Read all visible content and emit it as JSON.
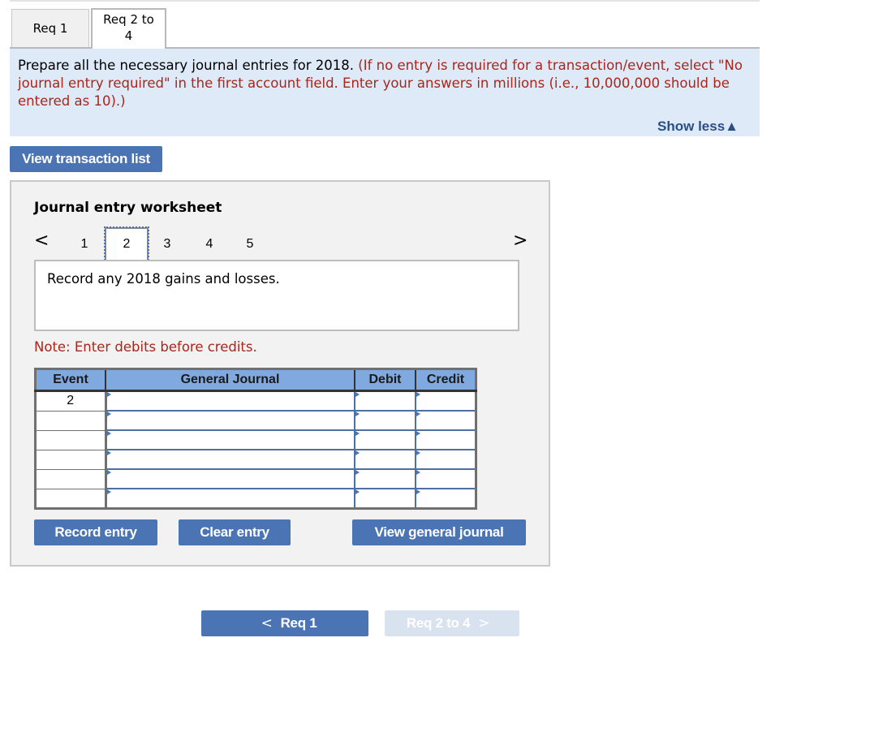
{
  "tabs": [
    {
      "label": "Req 1",
      "active": false
    },
    {
      "label_line1": "Req 2 to",
      "label_line2": "4",
      "active": true
    }
  ],
  "instructions": {
    "main": "Prepare all the necessary journal entries for 2018.",
    "note": "(If no entry is required for a transaction/event, select \"No journal entry required\" in the first account field. Enter your answers in millions (i.e., 10,000,000 should be entered as 10).)",
    "show_less_label": "Show less",
    "show_less_icon": "▲"
  },
  "view_transaction_list_label": "View transaction list",
  "worksheet": {
    "title": "Journal entry worksheet",
    "pager": {
      "prev_icon": "<",
      "next_icon": ">",
      "pages": [
        "1",
        "2",
        "3",
        "4",
        "5"
      ],
      "current": "2"
    },
    "description": "Record any 2018 gains and losses.",
    "note": "Note: Enter debits before credits.",
    "table": {
      "headers": [
        "Event",
        "General Journal",
        "Debit",
        "Credit"
      ],
      "rows": [
        {
          "event": "2",
          "account": "",
          "debit": "",
          "credit": ""
        },
        {
          "event": "",
          "account": "",
          "debit": "",
          "credit": ""
        },
        {
          "event": "",
          "account": "",
          "debit": "",
          "credit": ""
        },
        {
          "event": "",
          "account": "",
          "debit": "",
          "credit": ""
        },
        {
          "event": "",
          "account": "",
          "debit": "",
          "credit": ""
        },
        {
          "event": "",
          "account": "",
          "debit": "",
          "credit": ""
        }
      ]
    },
    "buttons": {
      "record": "Record entry",
      "clear": "Clear entry",
      "view_general_journal": "View general journal"
    }
  },
  "bottom_nav": {
    "prev_label": "Req 1",
    "prev_icon": "<",
    "next_label": "Req 2 to 4",
    "next_icon": ">"
  },
  "colors": {
    "primary_button": "#4a74b4",
    "disabled_button": "#d9e3f0",
    "instruction_bg": "#deeaf7",
    "note_red": "#a8261b",
    "table_header": "#80a9df"
  }
}
